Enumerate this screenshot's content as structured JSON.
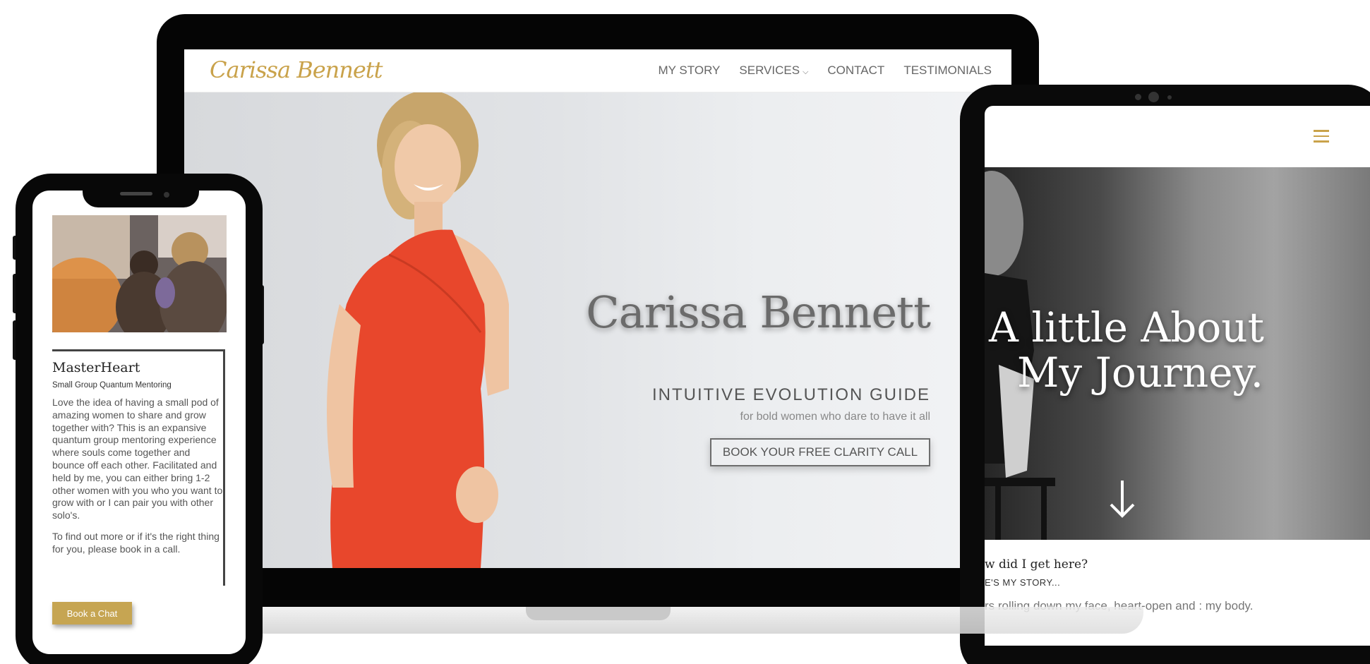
{
  "laptop": {
    "logo_text": "Carissa Bennett",
    "nav": [
      {
        "label": "MY STORY"
      },
      {
        "label": "SERVICES",
        "has_dropdown": true
      },
      {
        "label": "CONTACT"
      },
      {
        "label": "TESTIMONIALS"
      }
    ],
    "hero": {
      "title": "Carissa Bennett",
      "subtitle": "INTUITIVE EVOLUTION GUIDE",
      "tagline": "for bold women who dare to have it all",
      "cta_label": "BOOK YOUR FREE CLARITY CALL"
    }
  },
  "phone": {
    "card": {
      "title": "MasterHeart",
      "subtitle": "Small Group Quantum Mentoring",
      "paragraph_1": "Love the idea of having a small pod of amazing women to share and grow together with? This is an expansive quantum group mentoring experience where souls come together and bounce off each other. Facilitated and held by me, you can either bring 1-2 other women with you who you want to grow with or I can pair you with other solo's.",
      "paragraph_2": "To find out more or if it's the right thing for you, please book in a call.",
      "button_label": "Book a Chat"
    }
  },
  "tablet": {
    "hero_title_line1": "A little About",
    "hero_title_line2": "My Journey.",
    "heading": "w did I get here?",
    "subheading": "E'S MY STORY...",
    "body_text": "rs rolling down my face, heart-open and      : my body."
  },
  "colors": {
    "gold": "#c9a24a",
    "button_gold": "#c6a552",
    "dress_red": "#e8472c"
  },
  "icons": [
    "hamburger-menu-icon",
    "down-arrow-icon",
    "chevron-down-icon"
  ]
}
